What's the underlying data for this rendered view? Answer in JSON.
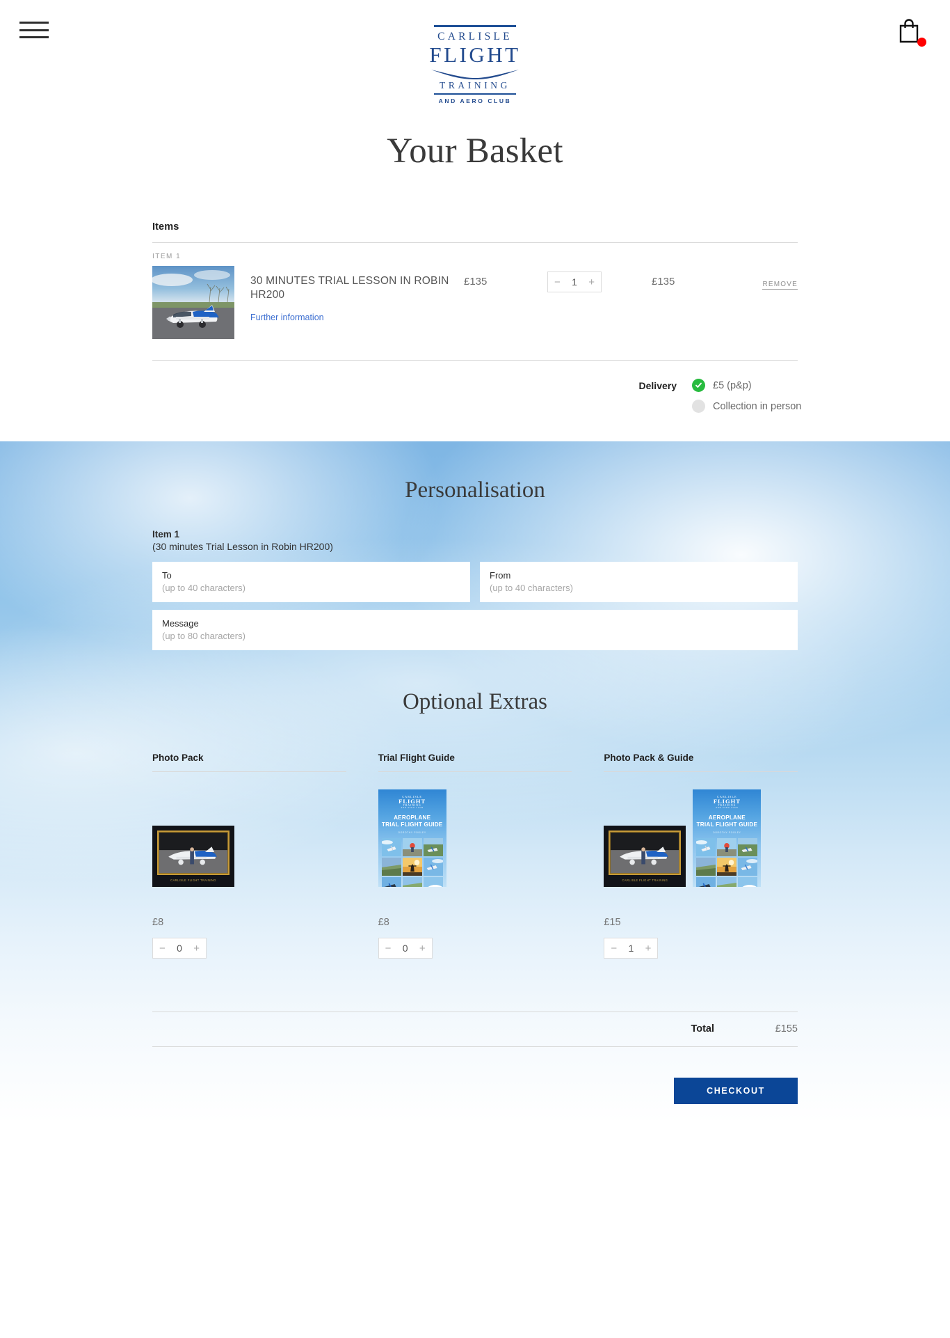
{
  "header": {
    "menu_icon": "hamburger-menu-icon",
    "basket_icon": "shopping-bag-icon",
    "logo": {
      "line1": "CARLISLE",
      "line2": "FLIGHT",
      "line3": "TRAINING",
      "line4": "AND AERO CLUB",
      "color": "#234b8e"
    }
  },
  "page": {
    "title": "Your Basket"
  },
  "items_section": {
    "heading": "Items",
    "rows": [
      {
        "index_label": "ITEM 1",
        "thumb_alt": "robin-hr200-aircraft-photo",
        "title": "30 MINUTES TRIAL LESSON IN ROBIN HR200",
        "link": "Further information",
        "unit_price": "£135",
        "quantity": "1",
        "minus": "−",
        "plus": "+",
        "subtotal": "£135",
        "remove": "REMOVE"
      }
    ]
  },
  "delivery": {
    "label": "Delivery",
    "options": [
      {
        "text": "£5 (p&p)",
        "selected": true,
        "color": "#28bb3f"
      },
      {
        "text": "Collection in person",
        "selected": false,
        "color": "#e2e2e2"
      }
    ]
  },
  "personalisation": {
    "title": "Personalisation",
    "item_heading": "Item 1",
    "item_sub": "(30 minutes Trial Lesson in Robin HR200)",
    "fields": [
      {
        "label": "To",
        "hint": "(up to 40 characters)",
        "value": ""
      },
      {
        "label": "From",
        "hint": "(up to 40 characters)",
        "value": ""
      },
      {
        "label": "Message",
        "hint": "(up to 80 characters)",
        "value": ""
      }
    ]
  },
  "optional_extras": {
    "title": "Optional Extras",
    "columns": [
      {
        "title": "Photo Pack",
        "media": "framed-photo-print",
        "price": "£8",
        "quantity": "0",
        "minus": "−",
        "plus": "+"
      },
      {
        "title": "Trial Flight Guide",
        "media": "trial-flight-guide-booklet",
        "price": "£8",
        "quantity": "0",
        "minus": "−",
        "plus": "+"
      },
      {
        "title": "Photo Pack & Guide",
        "media": "framed-photo-and-booklet",
        "price": "£15",
        "quantity": "1",
        "minus": "−",
        "plus": "+"
      }
    ]
  },
  "photo_pack_caption": "CARLISLE FLIGHT TRAINING",
  "booklet": {
    "logo_line1": "CARLISLE",
    "logo_line2": "FLIGHT",
    "logo_line3": "TRAINING",
    "logo_line4": "AND AERO CLUB",
    "title_line1": "AEROPLANE",
    "title_line2": "TRIAL FLIGHT GUIDE",
    "author": "DOROTHY POOLEY"
  },
  "totals": {
    "label": "Total",
    "value": "£155"
  },
  "checkout": {
    "label": "CHECKOUT",
    "color": "#0b4697"
  }
}
